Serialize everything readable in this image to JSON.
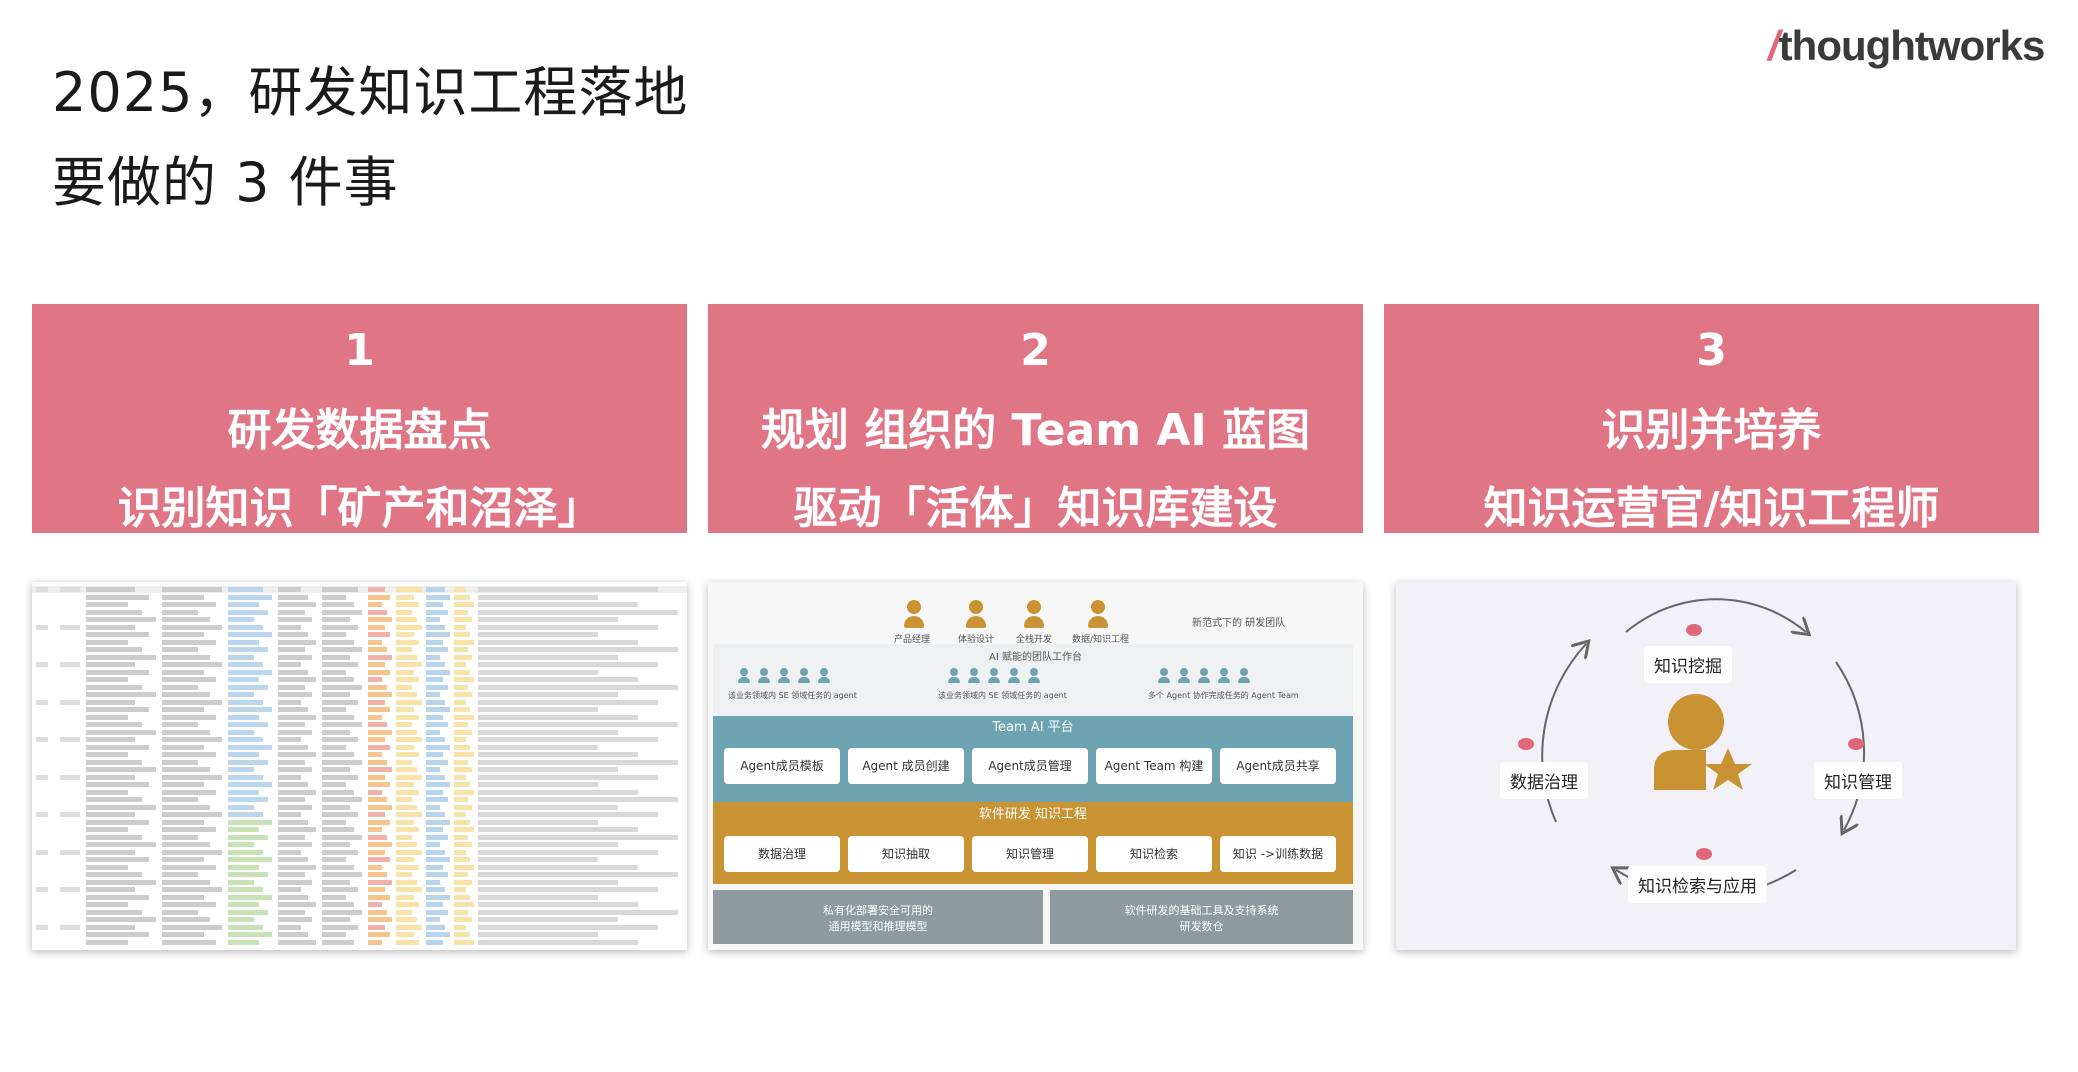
{
  "title": {
    "line1": "2025，研发知识工程落地",
    "line2": "要做的 3 件事"
  },
  "brand": {
    "slash": "/",
    "name": "thoughtworks"
  },
  "colors": {
    "card": "#e07585",
    "gold": "#c99233",
    "teal": "#6ea4b1",
    "gray": "#8f9a9e",
    "accent": "#e0687a"
  },
  "cards": [
    {
      "num": "1",
      "line1": "研发数据盘点",
      "line2": "识别知识「矿产和沼泽」"
    },
    {
      "num": "2",
      "line1": "规划 组织的 Team AI 蓝图",
      "line2": "驱动「活体」知识库建设"
    },
    {
      "num": "3",
      "line1": "识别并培养",
      "line2": "知识运营官/知识工程师"
    }
  ],
  "diagram2": {
    "roles": [
      "产品经理",
      "体验设计",
      "全栈开发",
      "数据/知识工程"
    ],
    "new_team": "新范式下的 研发团队",
    "workbench": "AI 赋能的团队工作台",
    "agents_notes": [
      "该业务领域内 SE 领域任务的 agent",
      "该业务领域内 SE 领域任务的 agent",
      "多个 Agent 协作完成任务的 Agent Team"
    ],
    "platform_title": "Team AI 平台",
    "platform_boxes": [
      "Agent成员模板",
      "Agent 成员创建",
      "Agent成员管理",
      "Agent Team 构建",
      "Agent成员共享"
    ],
    "knowledge_title": "软件研发 知识工程",
    "knowledge_boxes": [
      "数据治理",
      "知识抽取",
      "知识管理",
      "知识检索",
      "知识 ->训练数据"
    ],
    "bottom_left": "私有化部署安全可用的\n通用模型和推理模型",
    "bottom_right": "软件研发的基础工具及支持系统\n研发数仓"
  },
  "diagram3": {
    "top": "知识挖掘",
    "left": "数据治理",
    "right": "知识管理",
    "bottom": "知识检索与应用"
  }
}
